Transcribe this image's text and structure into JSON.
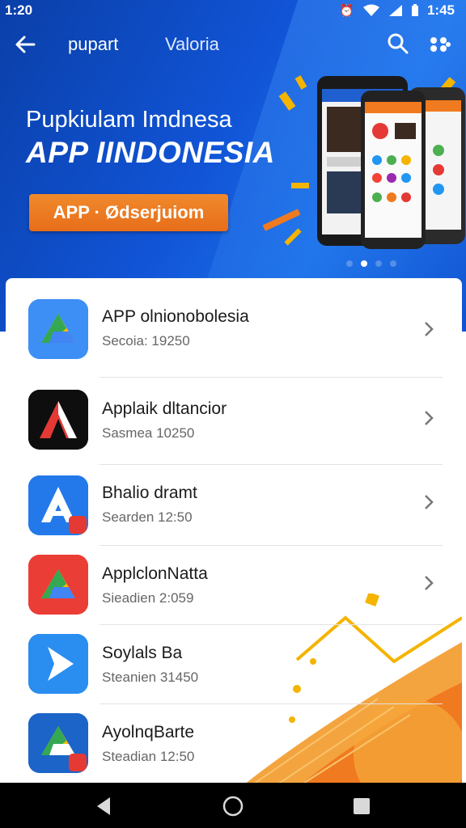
{
  "status_bar": {
    "time": "1:20",
    "right_time": "1:45"
  },
  "toolbar": {
    "title": "pupart",
    "subtitle": "Valoria"
  },
  "hero": {
    "line1": "Pupkiulam Imdnesa",
    "line2": "APP IINDONESIA",
    "button_label": "APP · Ødserjuiom",
    "carousel_pages": 4,
    "carousel_active": 2
  },
  "apps": [
    {
      "title": "APP olnionobolesia",
      "subtitle": "Secoia: 19250",
      "icon": "drive-triangle-icon",
      "color": "#2f80ed"
    },
    {
      "title": "Applaik dltancior",
      "subtitle": "Sasmea 10250",
      "icon": "letter-a-icon",
      "color": "#111111"
    },
    {
      "title": "Bhalio dramt",
      "subtitle": "Searden 12:50",
      "icon": "letter-a-icon",
      "color": "#1f6fe0"
    },
    {
      "title": "ApplclonNatta",
      "subtitle": "Sieadien 2:059",
      "icon": "drive-triangle-icon",
      "color": "#e53935"
    },
    {
      "title": "Soylals Ba",
      "subtitle": "Steanien 31450",
      "icon": "play-arrow-icon",
      "color": "#1e88e5"
    },
    {
      "title": "AyolnqBarte",
      "subtitle": "Steadian 12:50",
      "icon": "drive-triangle-icon",
      "color": "#1565c0"
    }
  ],
  "colors": {
    "hero": "#1154d6",
    "accent": "#e86d1a",
    "nav": "#000000"
  }
}
